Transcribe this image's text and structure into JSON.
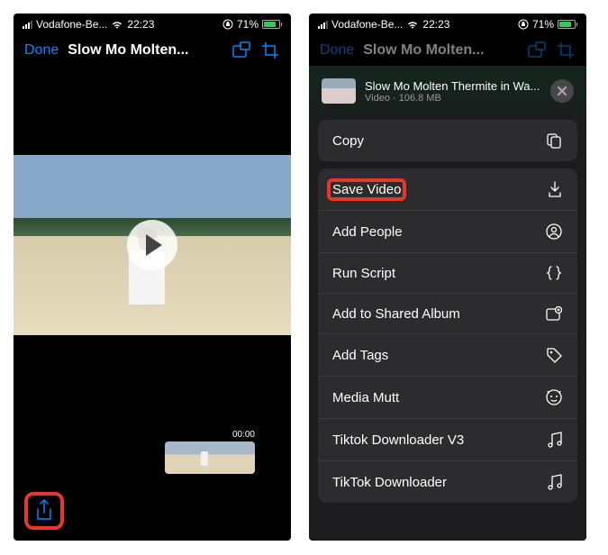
{
  "status": {
    "carrier": "Vodafone-Be...",
    "time": "22:23",
    "battery_percent": "71%"
  },
  "left": {
    "done": "Done",
    "title": "Slow Mo Molten...",
    "timestamp": "00:00"
  },
  "right": {
    "done": "Done",
    "title_dim": "Slow Mo Molten...",
    "sheet": {
      "title": "Slow Mo Molten Thermite in Wa...",
      "type": "Video",
      "size": "106.8 MB"
    },
    "actions": {
      "copy": "Copy",
      "save_video": "Save Video",
      "add_people": "Add People",
      "run_script": "Run Script",
      "add_shared": "Add to Shared Album",
      "add_tags": "Add Tags",
      "media_mutt": "Media Mutt",
      "tiktok_v3": "Tiktok Downloader V3",
      "tiktok": "TikTok Downloader"
    }
  }
}
